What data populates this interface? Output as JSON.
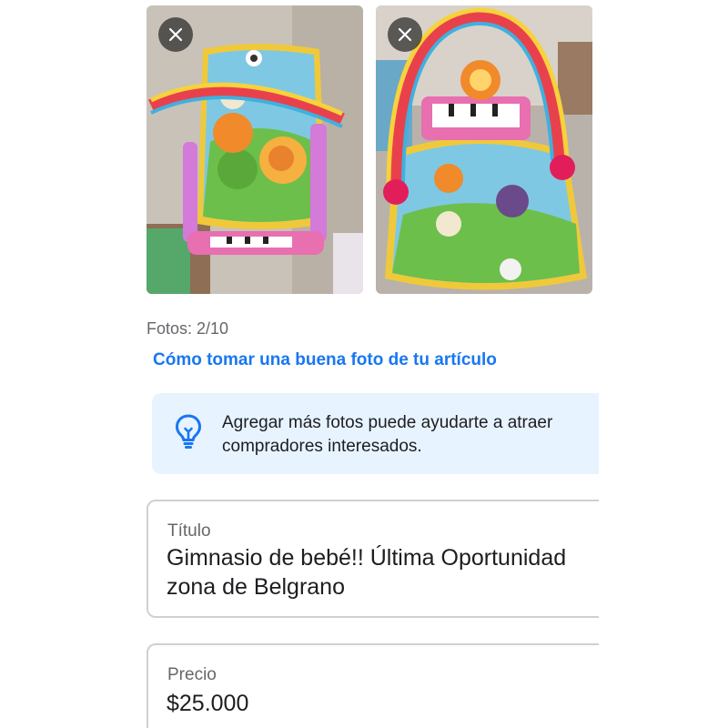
{
  "photos": {
    "count_text": "Fotos: 2/10",
    "tips_link": "Cómo tomar una buena foto de tu artículo",
    "items": [
      {
        "icon": "close-icon"
      },
      {
        "icon": "close-icon"
      }
    ]
  },
  "tip": {
    "icon": "lightbulb-icon",
    "line1": "Agregar más fotos puede ayudarte a atraer",
    "line2": "compradores interesados."
  },
  "form": {
    "title": {
      "label": "Título",
      "line1": "Gimnasio de bebé!! Última Oportunidad",
      "line2": "zona de Belgrano"
    },
    "price": {
      "label": "Precio",
      "value": "$25.000"
    }
  },
  "colors": {
    "accent": "#1877f2",
    "tip_background": "#e7f3ff",
    "muted_text": "#65676b",
    "border": "#ced0d4"
  }
}
